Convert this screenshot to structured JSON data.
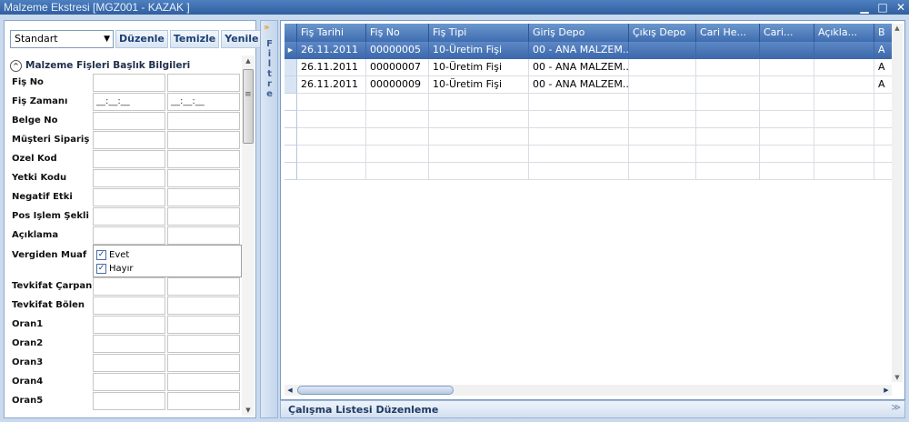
{
  "window": {
    "title": "Malzeme Ekstresi [MGZ001 - KAZAK ]",
    "minimize": "▁",
    "restore": "□",
    "close": "✕"
  },
  "toolbar": {
    "view_select": "Standart",
    "edit_label": "Düzenle",
    "clear_label": "Temizle",
    "refresh_label": "Yenile"
  },
  "section": {
    "title": "Malzeme Fişleri Başlık Bilgileri"
  },
  "fields": [
    {
      "label": "Fiş No",
      "v1": "",
      "v2": ""
    },
    {
      "label": "Fiş Zamanı",
      "v1": "__:__:__",
      "v2": "__:__:__"
    },
    {
      "label": "Belge No",
      "v1": "",
      "v2": ""
    },
    {
      "label": "Müşteri Sipariş No",
      "v1": "",
      "v2": ""
    },
    {
      "label": "Özel Kod",
      "v1": "",
      "v2": ""
    },
    {
      "label": "Yetki Kodu",
      "v1": "",
      "v2": ""
    },
    {
      "label": "Negatif Etki",
      "v1": "",
      "v2": ""
    },
    {
      "label": "Pos İşlem Şekli",
      "v1": "",
      "v2": ""
    },
    {
      "label": "Açıklama",
      "v1": "",
      "v2": ""
    },
    {
      "label": "Vergiden Muaf"
    },
    {
      "label": "Tevkifat Çarpan",
      "v1": "",
      "v2": ""
    },
    {
      "label": "Tevkifat Bölen",
      "v1": "",
      "v2": ""
    },
    {
      "label": "Oran1",
      "v1": "",
      "v2": ""
    },
    {
      "label": "Oran2",
      "v1": "",
      "v2": ""
    },
    {
      "label": "Oran3",
      "v1": "",
      "v2": ""
    },
    {
      "label": "Oran4",
      "v1": "",
      "v2": ""
    },
    {
      "label": "Oran5",
      "v1": "",
      "v2": ""
    }
  ],
  "vergiden_muaf": {
    "opt1": "Evet",
    "opt2": "Hayır",
    "check_mark": "✓"
  },
  "splitter": {
    "label": "Filtre"
  },
  "grid": {
    "columns": [
      "Fiş Tarihi",
      "Fiş No",
      "Fiş Tipi",
      "Giriş Depo",
      "Çıkış Depo",
      "Cari He...",
      "Cari...",
      "Açıkla...",
      "B"
    ],
    "rows": [
      [
        "26.11.2011",
        "00000005",
        "10-Üretim Fişi",
        "00 - ANA MALZEM...",
        "",
        "",
        "",
        "",
        "A"
      ],
      [
        "26.11.2011",
        "00000007",
        "10-Üretim Fişi",
        "00 - ANA MALZEM...",
        "",
        "",
        "",
        "",
        "A"
      ],
      [
        "26.11.2011",
        "00000009",
        "10-Üretim Fişi",
        "00 - ANA MALZEM...",
        "",
        "",
        "",
        "",
        "A"
      ]
    ],
    "current_row_marker": "▶"
  },
  "bottombar": {
    "label": "Çalışma Listesi Düzenleme"
  },
  "icons": {
    "combo_arrow": "▼",
    "scroll_up": "▲",
    "scroll_down": "▼",
    "scroll_left": "◀",
    "scroll_right": "▶",
    "collapse": "^",
    "grip": "≡",
    "splitter_chev": "»",
    "expand": "≫"
  }
}
